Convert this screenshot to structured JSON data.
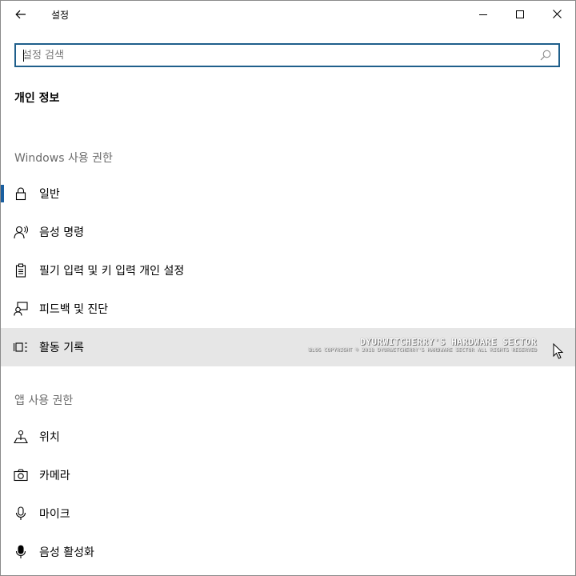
{
  "window": {
    "title": "설정",
    "icons": {
      "back": "arrow-left-icon",
      "minimize": "minimize-icon",
      "maximize": "maximize-icon",
      "close": "close-icon"
    }
  },
  "search": {
    "placeholder": "설정 검색",
    "value": "",
    "icon": "search-icon"
  },
  "page": {
    "title": "개인 정보"
  },
  "sections": [
    {
      "header": "Windows 사용 권한",
      "items": [
        {
          "label": "일반",
          "icon": "lock-icon",
          "selected": true
        },
        {
          "label": "음성 명령",
          "icon": "speech-person-icon"
        },
        {
          "label": "필기 입력 및 키 입력 개인 설정",
          "icon": "clipboard-icon"
        },
        {
          "label": "피드백 및 진단",
          "icon": "feedback-person-icon"
        },
        {
          "label": "활동 기록",
          "icon": "activity-timeline-icon",
          "hovered": true
        }
      ]
    },
    {
      "header": "앱 사용 권한",
      "items": [
        {
          "label": "위치",
          "icon": "location-icon"
        },
        {
          "label": "카메라",
          "icon": "camera-icon"
        },
        {
          "label": "마이크",
          "icon": "microphone-icon"
        },
        {
          "label": "음성 활성화",
          "icon": "microphone-filled-icon"
        }
      ]
    }
  ],
  "watermark": {
    "main": "DYURWITCHERRY'S HARDWARE SECTOR",
    "sub": "BLOG COPYRIGHT © 2018 DYURWITCHERRY'S HARDWARE SECTOR ALL RIGHTS RESERVED"
  },
  "colors": {
    "accent": "#1a5fa0",
    "search_border": "#1f5f8b",
    "hover_bg": "#e6e6e6",
    "section_header": "#6b6b6b"
  }
}
